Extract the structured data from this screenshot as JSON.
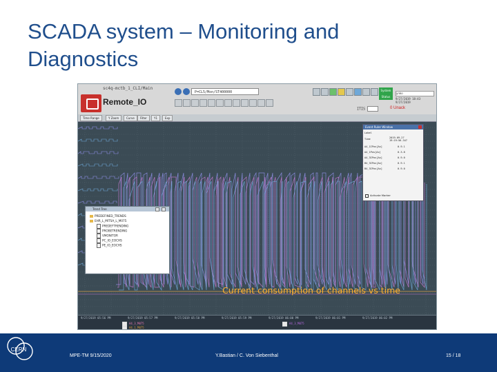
{
  "slide": {
    "title_line1": "SCADA system – Monitoring and",
    "title_line2": "Diagnostics"
  },
  "app": {
    "panel_title": "sc4q-mctb_1_CLI/Main",
    "name": "Remote_IO",
    "address_value": "P=CL5/Mon/ST400000",
    "status_label": "System Status",
    "user_field": "ynko",
    "user_info": "9/27/2019 18:43   9/27/2019",
    "ack_label": "0 Unack",
    "selector_label": "ITIS",
    "toolbar_items": [
      "Time Range",
      "Y Zoom",
      "Curve",
      "Filter",
      "Y1",
      "Exp"
    ]
  },
  "tree_window": {
    "title": "Trend Tree",
    "items": [
      {
        "label": "PREDEFINED_TRENDS",
        "type": "folder",
        "indent": 0
      },
      {
        "label": "EHR_L_MITSA_L_M075",
        "type": "folder",
        "indent": 0
      },
      {
        "label": "PREDEFTRENDING",
        "type": "doc",
        "indent": 1
      },
      {
        "label": "PROBETRENDING",
        "type": "doc",
        "indent": 1
      },
      {
        "label": "VMONITOR",
        "type": "doc",
        "indent": 1
      },
      {
        "label": "PC_IO_EOCHS",
        "type": "doc",
        "indent": 1
      },
      {
        "label": "PE_IO_EOCHS",
        "type": "doc",
        "indent": 1
      }
    ]
  },
  "ruler_window": {
    "title": "Event Ruler Window",
    "rows": [
      {
        "label": "Label",
        "value": ""
      },
      {
        "label": "Time",
        "value": "2019.09.27 19:19:56.347"
      },
      {
        "label": "A4_1IPos[Ax]",
        "value": "0.9.1"
      },
      {
        "label": "A4_1Pos[Ax]",
        "value": "0.3.8"
      },
      {
        "label": "A4_3IPos[Ax]",
        "value": "0.9.0"
      },
      {
        "label": "B4_3IPos[Ax]",
        "value": "0.9.1"
      },
      {
        "label": "B4_3IPos[Ax]",
        "value": "0.9.0"
      }
    ],
    "checkbox_label": "Activate Marker"
  },
  "plot": {
    "caption": "Current consumption of channels vs time",
    "x_ticks": [
      "9/27/2019 05:56 PM",
      "9/27/2019 05:57 PM",
      "9/27/2019 05:58 PM",
      "9/27/2019 05:59 PM",
      "9/27/2019 06:00 PM",
      "9/27/2019 06:01 PM",
      "9/27/2019 06:02 PM"
    ],
    "legend": [
      {
        "label": "A4_3_M075",
        "color": "#e87ab5"
      },
      {
        "label": "A4_1_M075",
        "color": "#d99a3a"
      },
      {
        "label": "A4_3_M075",
        "color": "#b56adf"
      }
    ],
    "series_colors": [
      "#8f8fe8",
      "#c57bd0",
      "#6fa8d8",
      "#d8a04a"
    ]
  },
  "footer": {
    "org": "CERN",
    "left": "MPE-TM 9/15/2020",
    "center": "Y.Bastian / C. Von Siebenthal",
    "page": "15 / 18",
    "bg_color": "#0e3a78"
  }
}
